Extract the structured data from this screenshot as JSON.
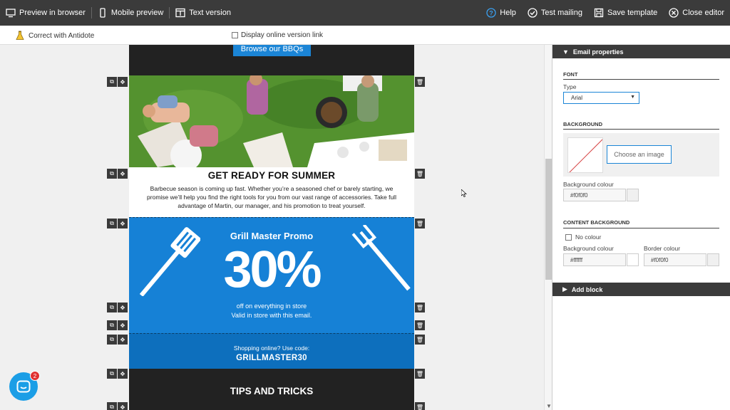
{
  "toolbar": {
    "preview_browser": "Preview in browser",
    "mobile_preview": "Mobile preview",
    "text_version": "Text version",
    "help": "Help",
    "test_mailing": "Test mailing",
    "save_template": "Save template",
    "close_editor": "Close editor"
  },
  "subbar": {
    "antidote": "Correct with Antidote",
    "online_link": "Display online version link"
  },
  "email": {
    "browse_button": "Browse our BBQs",
    "headline": "GET READY FOR SUMMER",
    "body": "Barbecue season is coming up fast. Whether you’re a seasoned chef or barely starting, we promise we’ll help you find the right tools for you from our vast range of accessories. Take full advantage of Martin, our manager, and his promotion to treat yourself.",
    "promo_title": "Grill Master Promo",
    "promo_percent": "30%",
    "promo_line1": "off on everything in store",
    "promo_line2": "Valid in store with this email.",
    "code_line1": "Shopping online? Use code:",
    "code_value": "GRILLMASTER30",
    "tips_title": "TIPS AND TRICKS"
  },
  "chat": {
    "badge": "2"
  },
  "panel": {
    "email_properties": "Email properties",
    "font_section": "FONT",
    "type_label": "Type",
    "font_value": "Arial",
    "background_section": "BACKGROUND",
    "choose_image": "Choose an image",
    "bg_colour_label": "Background colour",
    "bg_colour_value": "#f0f0f0",
    "content_bg_section": "CONTENT BACKGROUND",
    "no_colour": "No colour",
    "content_bg_label": "Background colour",
    "content_bg_value": "#ffffff",
    "border_label": "Border colour",
    "border_value": "#f0f0f0",
    "add_block": "Add block"
  },
  "colors": {
    "toolbar": "#3b3b3b",
    "accent": "#1b85d6",
    "promo_blue": "#1681d6"
  }
}
